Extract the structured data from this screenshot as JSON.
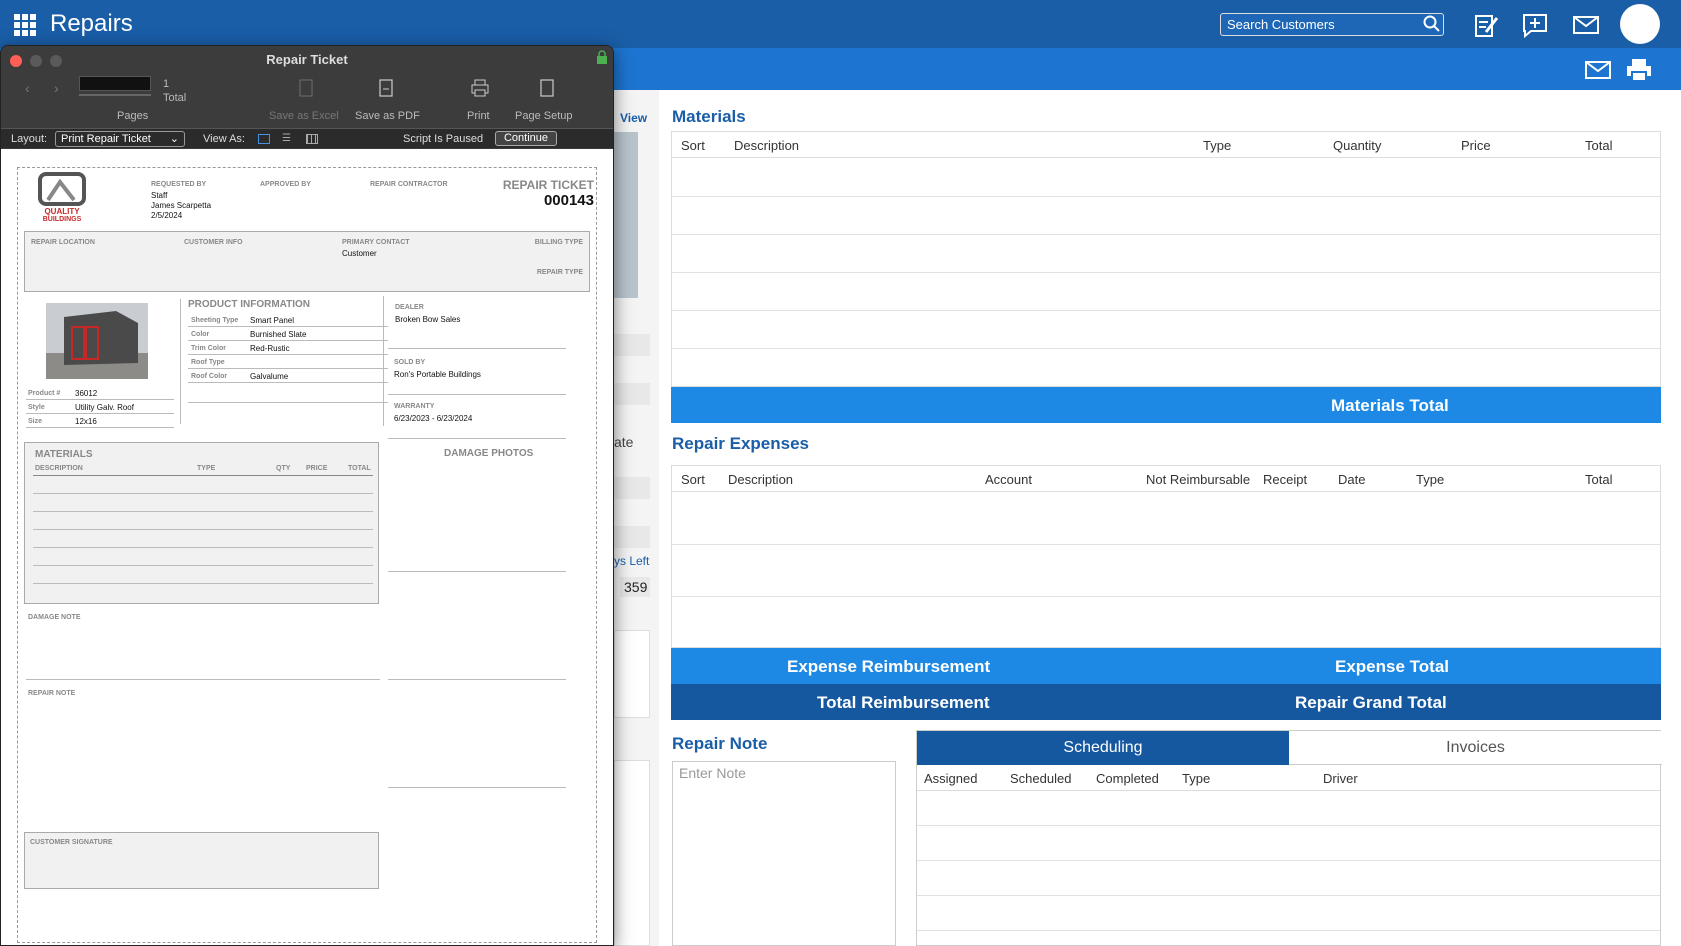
{
  "header": {
    "app_title": "Repairs",
    "search_placeholder": "Search Customers"
  },
  "background_fragments": {
    "view_link": "View",
    "date_fragment": "ate",
    "days_left_fragment": "ys Left",
    "days_left_value": "359"
  },
  "materials": {
    "title": "Materials",
    "columns": [
      "Sort",
      "Description",
      "Type",
      "Quantity",
      "Price",
      "Total"
    ],
    "total_label": "Materials Total"
  },
  "expenses": {
    "title": "Repair Expenses",
    "columns": [
      "Sort",
      "Description",
      "Account",
      "Not Reimbursable",
      "Receipt",
      "Date",
      "Type",
      "Total"
    ],
    "reimbursement_label": "Expense Reimbursement",
    "expense_total_label": "Expense Total",
    "total_reimbursement_label": "Total Reimbursement",
    "grand_total_label": "Repair Grand Total"
  },
  "repair_note": {
    "title": "Repair Note",
    "placeholder": "Enter Note"
  },
  "tabs": {
    "scheduling": "Scheduling",
    "invoices": "Invoices",
    "columns": [
      "Assigned",
      "Scheduled",
      "Completed",
      "Type",
      "Driver"
    ]
  },
  "window": {
    "title": "Repair Ticket",
    "page_count": "1",
    "total_label": "Total",
    "pages_label": "Pages",
    "save_excel": "Save as Excel",
    "save_pdf": "Save as PDF",
    "print": "Print",
    "page_setup": "Page Setup",
    "layout_label": "Layout:",
    "layout_value": "Print Repair Ticket",
    "view_as_label": "View As:",
    "script_paused": "Script Is Paused",
    "continue": "Continue"
  },
  "ticket": {
    "logo_text": "QUALITY BUILDINGS",
    "requested_by_label": "REQUESTED BY",
    "requested_by_role": "Staff",
    "requested_by_name": "James Scarpetta",
    "requested_date": "2/5/2024",
    "approved_by_label": "APPROVED BY",
    "repair_contractor_label": "REPAIR CONTRACTOR",
    "ticket_label": "REPAIR TICKET",
    "ticket_number": "000143",
    "repair_location_label": "REPAIR LOCATION",
    "customer_info_label": "CUSTOMER INFO",
    "primary_contact_label": "PRIMARY CONTACT",
    "primary_contact_value": "Customer",
    "billing_type_label": "BILLING TYPE",
    "repair_type_label": "REPAIR TYPE",
    "product_info_label": "PRODUCT INFORMATION",
    "product_rows": [
      {
        "label": "Sheeting Type",
        "value": "Smart Panel"
      },
      {
        "label": "Color",
        "value": "Burnished Slate"
      },
      {
        "label": "Trim Color",
        "value": "Red-Rustic"
      },
      {
        "label": "Roof Type",
        "value": ""
      },
      {
        "label": "Roof Color",
        "value": "Galvalume"
      }
    ],
    "product_num_label": "Product #",
    "product_num": "36012",
    "style_label": "Style",
    "style_value": "Utility Galv. Roof",
    "size_label": "Size",
    "size_value": "12x16",
    "dealer_label": "DEALER",
    "dealer_value": "Broken Bow Sales",
    "sold_by_label": "SOLD BY",
    "sold_by_value": "Ron's Portable Buildings",
    "warranty_label": "WARRANTY",
    "warranty_value": "6/23/2023 - 6/23/2024",
    "materials_label": "MATERIALS",
    "mat_cols": [
      "DESCRIPTION",
      "TYPE",
      "QTY",
      "PRICE",
      "TOTAL"
    ],
    "damage_photos_label": "DAMAGE PHOTOS",
    "damage_note_label": "DAMAGE NOTE",
    "repair_note_label": "REPAIR NOTE",
    "signature_label": "CUSTOMER SIGNATURE"
  }
}
